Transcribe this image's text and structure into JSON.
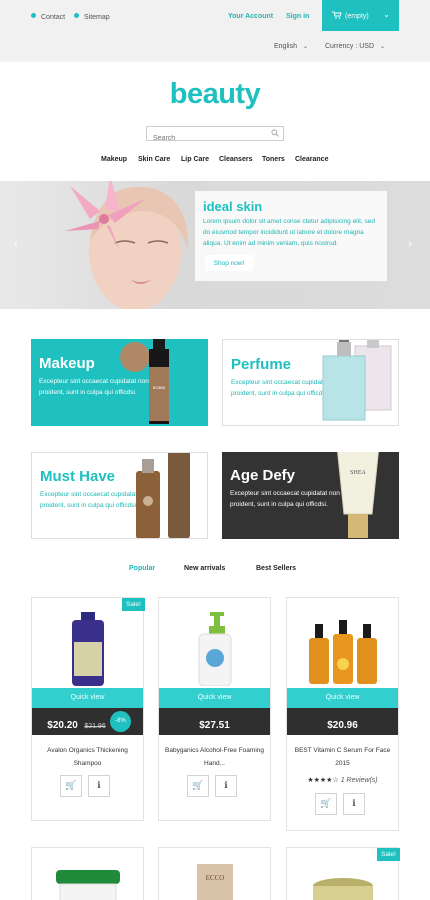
{
  "topbar": {
    "contact": "Contact",
    "sitemap": "Sitemap",
    "account": "Your Account",
    "signin": "Sign in",
    "cart": "(empty)",
    "language": "English",
    "currency": "Currency : USD"
  },
  "logo": "beauty",
  "search": {
    "placeholder": "Search"
  },
  "nav": [
    "Makeup",
    "Skin Care",
    "Lip Care",
    "Cleansers",
    "Toners",
    "Clearance"
  ],
  "hero": {
    "title": "ideal skin",
    "body": "Lorem ipsum dolor sit amet conse ctetur adipisicing elit, sed do eiusmod tempor incididunt ut labore et dolore magna aliqua. Ut enim ad minim veniam, quis nostrud.",
    "button": "Shop now!"
  },
  "banners": [
    {
      "title": "Makeup",
      "text": "Excepteur sint occaecat cupidatat non proident, sunt in culpa qui officdsi."
    },
    {
      "title": "Perfume",
      "text": "Excepteur sint occaecat cupidatat non proident, sunt in culpa qui officdsi."
    },
    {
      "title": "Must Have",
      "text": "Excepteur sint occaecat cupidatat non proident, sunt in culpa qui officdsi."
    },
    {
      "title": "Age Defy",
      "text": "Excepteur sint occaecat cupidatat non proident, sunt in culpa qui officdsi."
    }
  ],
  "tabs": [
    "Popular",
    "New arrivals",
    "Best Sellers"
  ],
  "products": [
    {
      "sale": "Sale!",
      "quick": "Quick view",
      "price": "$20.20",
      "old": "$21.96",
      "discount": "-8%",
      "name": "Avalon Organics Thickening Shampoo"
    },
    {
      "quick": "Quick view",
      "price": "$27.51",
      "name": "Babyganics Alcohol-Free Foaming Hand..."
    },
    {
      "quick": "Quick view",
      "price": "$20.96",
      "name": "BEST Vitamin C Serum For Face 2015",
      "rating": 4,
      "stars": "★★★★☆",
      "reviews": "1 Review(s)"
    },
    {},
    {},
    {
      "sale": "Sale!"
    }
  ],
  "colors": {
    "accent": "#1fc0c0",
    "dark": "#2f2f2f"
  }
}
